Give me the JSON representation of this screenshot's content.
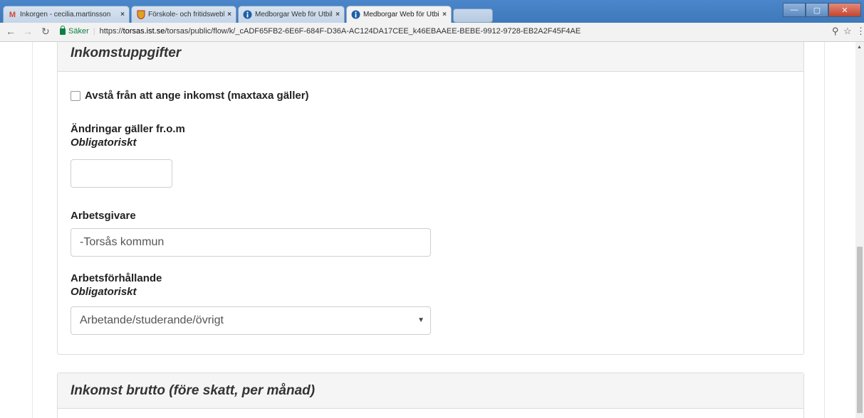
{
  "browser": {
    "tabs": [
      {
        "title": "Inkorgen - cecilia.martinsson",
        "favicon": "gmail-icon",
        "active": false
      },
      {
        "title": "Förskole- och fritidswebben",
        "favicon": "crest-icon",
        "active": false
      },
      {
        "title": "Medborgar Web för Utbildning",
        "favicon": "info-icon",
        "active": false
      },
      {
        "title": "Medborgar Web för Utbildning",
        "favicon": "info-icon",
        "active": true
      }
    ],
    "close_glyph": "×",
    "window_controls": {
      "minimize": "—",
      "restore": "▢",
      "close": "✕"
    },
    "address": {
      "secure_label": "Säker",
      "separator": "|",
      "url_scheme": "https://",
      "url_host": "torsas.ist.se",
      "url_path": "/torsas/public/flow/k/_cADF65FB2-6E6F-684F-D36A-AC124DA17CEE_k46EBAAEE-BEBE-9912-9728-EB2A2F45F4AE"
    }
  },
  "form": {
    "section_title": "Inkomstuppgifter",
    "skip_income_label": "Avstå från att ange inkomst (maxtaxa gäller)",
    "skip_income_checked": false,
    "changes_from_label": "Ändringar gäller fr.o.m",
    "changes_from_required": "Obligatoriskt",
    "changes_from_value": "",
    "employer_label": "Arbetsgivare",
    "employer_value": "-Torsås kommun",
    "employment_label": "Arbetsförhållande",
    "employment_required": "Obligatoriskt",
    "employment_selected": "Arbetande/studerande/övrigt",
    "next_section_title": "Inkomst brutto (före skatt, per månad)"
  }
}
